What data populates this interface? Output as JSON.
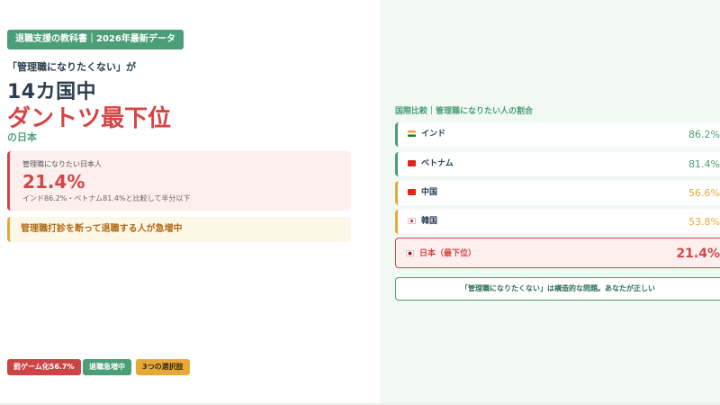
{
  "left": {
    "tag": "退職支援の教科書｜2026年最新データ",
    "lead": "「管理職になりたくない」が",
    "headline_1": "14カ国中",
    "headline_2": "ダントツ最下位",
    "headline_3": "の日本",
    "stat": {
      "label": "管理職になりたい日本人",
      "value": "21.4%",
      "note": "インド86.2%・ベトナム81.4%と比較して半分以下"
    },
    "alert": "管理職打診を断って退職する人が急増中",
    "chips": [
      {
        "label": "罰ゲーム化56.7%",
        "color": "#cc4444"
      },
      {
        "label": "退職急増中",
        "color": "#4a9e78"
      },
      {
        "label": "3つの選択肢",
        "color": "#e8a838"
      }
    ]
  },
  "right": {
    "section_title": "国際比較｜管理職になりたい人の割合",
    "countries": [
      {
        "name": "インド",
        "percent": "86.2%",
        "flag": "india-flag-icon",
        "accent": "#4a9e78"
      },
      {
        "name": "ベトナム",
        "percent": "81.4%",
        "flag": "vietnam-flag-icon",
        "accent": "#4a9e78"
      },
      {
        "name": "中国",
        "percent": "56.6%",
        "flag": "china-flag-icon",
        "accent": "#e8a838"
      },
      {
        "name": "韓国",
        "percent": "53.8%",
        "flag": "korea-flag-icon",
        "accent": "#e8a838"
      }
    ],
    "japan": {
      "name": "日本（最下位）",
      "percent": "21.4%",
      "flag": "japan-flag-icon",
      "accent": "#d64545"
    },
    "conclusion": "「管理職になりたくない」は構造的な問題。あなたが正しい"
  },
  "colors": {
    "brand_green": "#4a9e78",
    "alert_red": "#d64545",
    "warn_orange": "#e8a838",
    "navy": "#2c3e50"
  }
}
